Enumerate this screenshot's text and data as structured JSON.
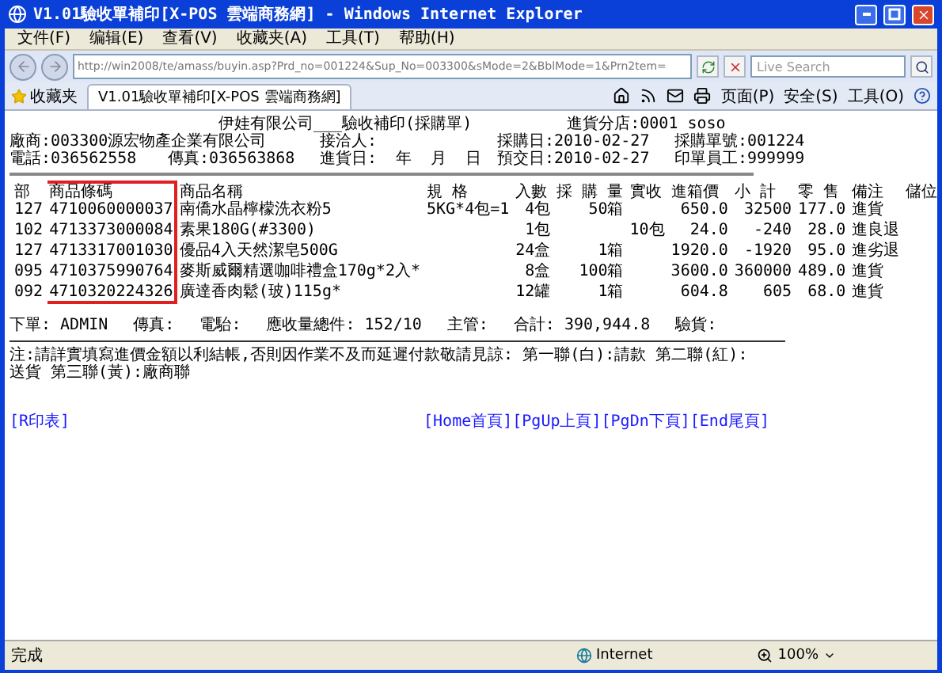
{
  "window": {
    "title": "V1.01驗收單補印[X-POS 雲端商務網] - Windows Internet Explorer"
  },
  "menu": [
    "文件(F)",
    "编辑(E)",
    "查看(V)",
    "收藏夹(A)",
    "工具(T)",
    "帮助(H)"
  ],
  "address_bar": {
    "url": "http://win2008/te/amass/buyin.asp?Prd_no=001224&Sup_No=003300&sMode=2&BblMode=1&Prn2tem="
  },
  "search": {
    "placeholder": "Live Search"
  },
  "favorites": {
    "label": "收藏夹"
  },
  "tabs": [
    {
      "label": "V1.01驗收單補印[X-POS 雲端商務網]",
      "selected": true
    }
  ],
  "command_bar": [
    "页面(P)",
    "安全(S)",
    "工具(O)"
  ],
  "document": {
    "title": "伊娃有限公司___驗收補印(採購單)",
    "branch": "進貨分店:0001 soso",
    "info_rows": [
      [
        {
          "text": "廠商:003300源宏物產企業有限公司",
          "wide": true
        },
        {
          "text": "接洽人:",
          "wide": false
        },
        {
          "text": "採購日:2010-02-27",
          "wide": false
        },
        {
          "text": "採購單號:001224",
          "wide": false
        }
      ],
      [
        {
          "text": "電話:036562558",
          "wide": false
        },
        {
          "text": "傳真:036563868",
          "wide": false
        },
        {
          "text": "進貨日:  年  月  日",
          "wide": false
        },
        {
          "text": "預交日:2010-02-27",
          "wide": false
        },
        {
          "text": "印單員工:999999",
          "wide": false
        }
      ]
    ],
    "table": {
      "columns": [
        {
          "label": "部",
          "highlighted": false
        },
        {
          "label": "商品條碼",
          "highlighted": true
        },
        {
          "label": "商品名稱",
          "highlighted": false
        },
        {
          "label": "規 格",
          "highlighted": false
        },
        {
          "label": "入數",
          "highlighted": false
        },
        {
          "label": "採 購 量",
          "highlighted": false
        },
        {
          "label": "實收",
          "highlighted": false
        },
        {
          "label": "進箱價",
          "highlighted": false
        },
        {
          "label": "小 計",
          "highlighted": false
        },
        {
          "label": "零 售",
          "highlighted": false
        },
        {
          "label": "備注",
          "highlighted": false
        },
        {
          "label": "儲位",
          "highlighted": false
        }
      ],
      "rows": [
        {
          "dept": "127",
          "barcode": "4710060000037",
          "name": "南僑水晶檸檬洗衣粉5",
          "spec": "5KG*4包=1",
          "pack": "4包",
          "qty": "50箱",
          "price": "650.0",
          "subtotal": "32500",
          "retail": "177.0",
          "note": "進貨"
        },
        {
          "dept": "102",
          "barcode": "4713373000084",
          "name": "素果180G(#3300)",
          "pack": "1包",
          "received": "10包",
          "price": "24.0",
          "subtotal": "-240",
          "retail": "28.0",
          "note": "進良退"
        },
        {
          "dept": "127",
          "barcode": "4713317001030",
          "name": "優品4入天然潔皂500G",
          "pack": "24盒",
          "qty": "1箱",
          "price": "1920.0",
          "subtotal": "-1920",
          "retail": "95.0",
          "note": "進劣退"
        },
        {
          "dept": "095",
          "barcode": "4710375990764",
          "name": "麥斯威爾精選咖啡禮盒170g*2入*",
          "pack": "8盒",
          "qty": "100箱",
          "price": "3600.0",
          "subtotal": "360000",
          "retail": "489.0",
          "note": "進貨"
        },
        {
          "dept": "092",
          "barcode": "4710320224326",
          "name": "廣達香肉鬆(玻)115g*",
          "pack": "12罐",
          "qty": "1箱",
          "price": "604.8",
          "subtotal": "605",
          "retail": "68.0",
          "note": "進貨"
        }
      ]
    },
    "footer_fields": [
      "下單: ADMIN",
      "傳真:",
      "電駘:",
      "應收量總件: 152/10",
      "主管:",
      "合計: 390,944.8",
      "驗貨:"
    ],
    "note": "注:請詳實填寫進價金額以利結帳,否則因作業不及而延遲付款敬請見諒: 第一聯(白):請款 第二聯(紅):送貨 第三聯(黃):廠商聯",
    "print_link": "[R印表]",
    "page_links": [
      "[Home首頁]",
      "[PgUp上頁]",
      "[PgDn下頁]",
      "[End尾頁]"
    ]
  },
  "status_bar": {
    "text": "完成",
    "zone": "Internet",
    "zoom": "100%"
  }
}
